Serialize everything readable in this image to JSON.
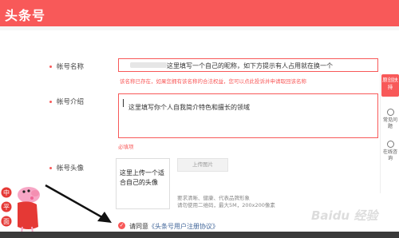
{
  "header": {
    "logo": "头条号",
    "color": "#f85959"
  },
  "form": {
    "name": {
      "label": "帐号名称",
      "value": "这里填写一个自己的昵称，如下方提示有人占用就在换一个",
      "hint": "该名称已存在，如果您拥有该名称的合法权益，您可以点此投诉并申请取回该名称"
    },
    "intro": {
      "label": "帐号介绍",
      "value": "这里填写你个人自我简介特色和擅长的领域",
      "hint": "必填项"
    },
    "avatar": {
      "label": "帐号头像",
      "box_text": "这里上传一个适合自己的头像",
      "upload_label": "上传图片",
      "req_line1": "要求清晰、健康、代表品牌形象",
      "req_line2": "请勿使用二维码，最大5M，200x200像素"
    },
    "agree": {
      "prefix": "请同意",
      "link": "《头条号用户注册协议》"
    }
  },
  "side": {
    "original": "原创扶持",
    "faq": "常见问题",
    "service": "在线咨询"
  },
  "sticker": {
    "chars": [
      "中",
      "平",
      "面"
    ]
  },
  "watermark": "Baidu 经验"
}
